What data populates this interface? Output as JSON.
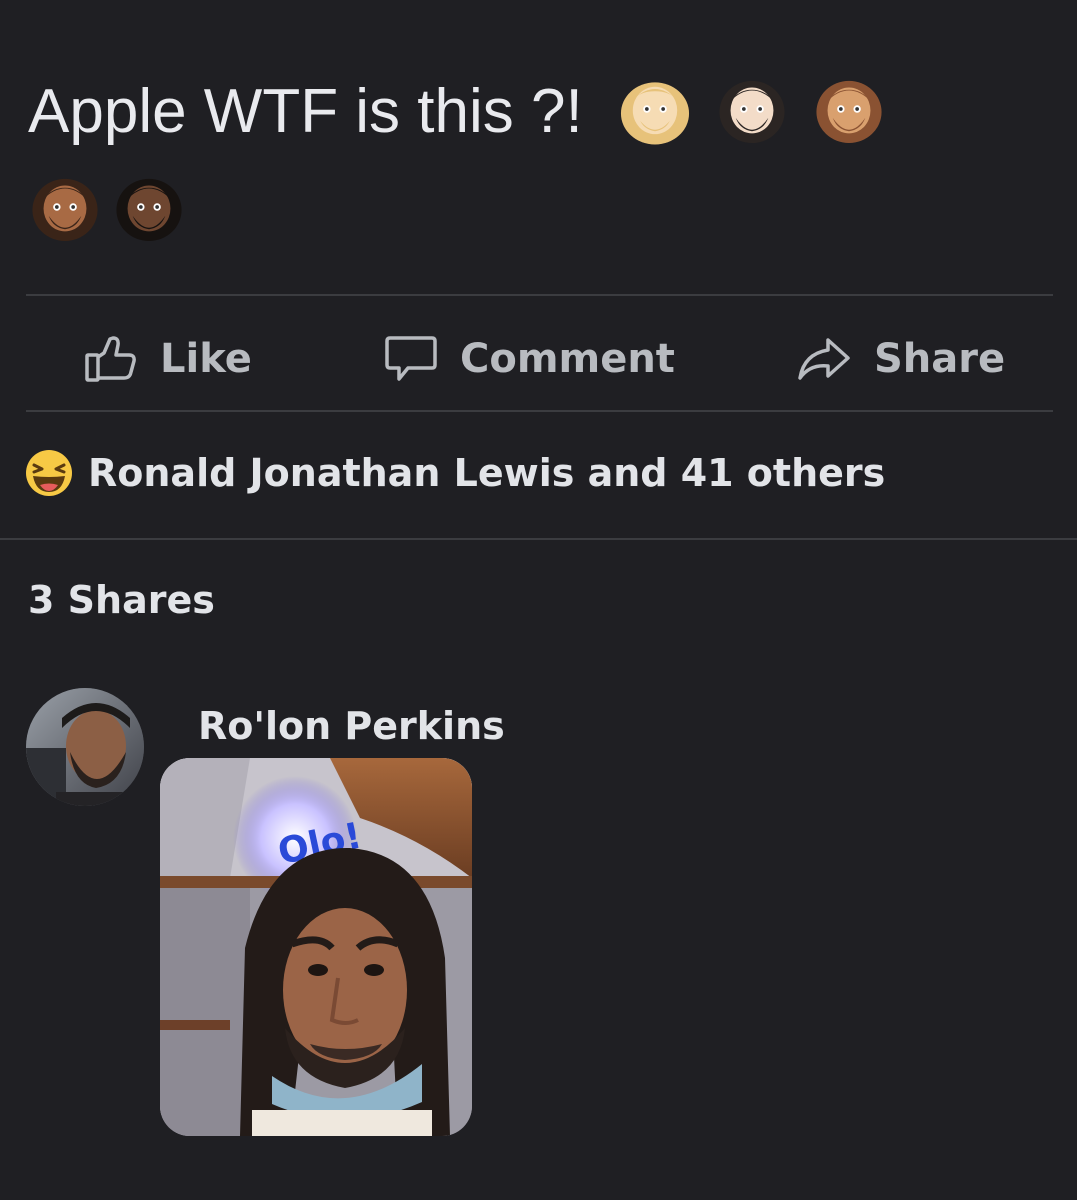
{
  "post": {
    "text": "Apple WTF is this ?!",
    "emojis": [
      "man-blond-beard-emoji",
      "man-light-beard-emoji",
      "man-medium-beard-emoji",
      "man-medium-dark-beard-emoji",
      "man-dark-beard-emoji"
    ]
  },
  "actions": {
    "like_label": "Like",
    "comment_label": "Comment",
    "share_label": "Share"
  },
  "reactions": {
    "icon": "laughing-face-icon",
    "summary": "Ronald Jonathan Lewis and 41 others"
  },
  "shares": {
    "count_label": "3 Shares"
  },
  "comment": {
    "author": "Ro'lon Perkins",
    "photo_sign_text": "Olo!"
  },
  "colors": {
    "background": "#1f1f23",
    "text": "#e4e6eb",
    "muted": "#b8bbc0",
    "divider": "#3b3c40",
    "reaction_yellow": "#f7c945"
  }
}
